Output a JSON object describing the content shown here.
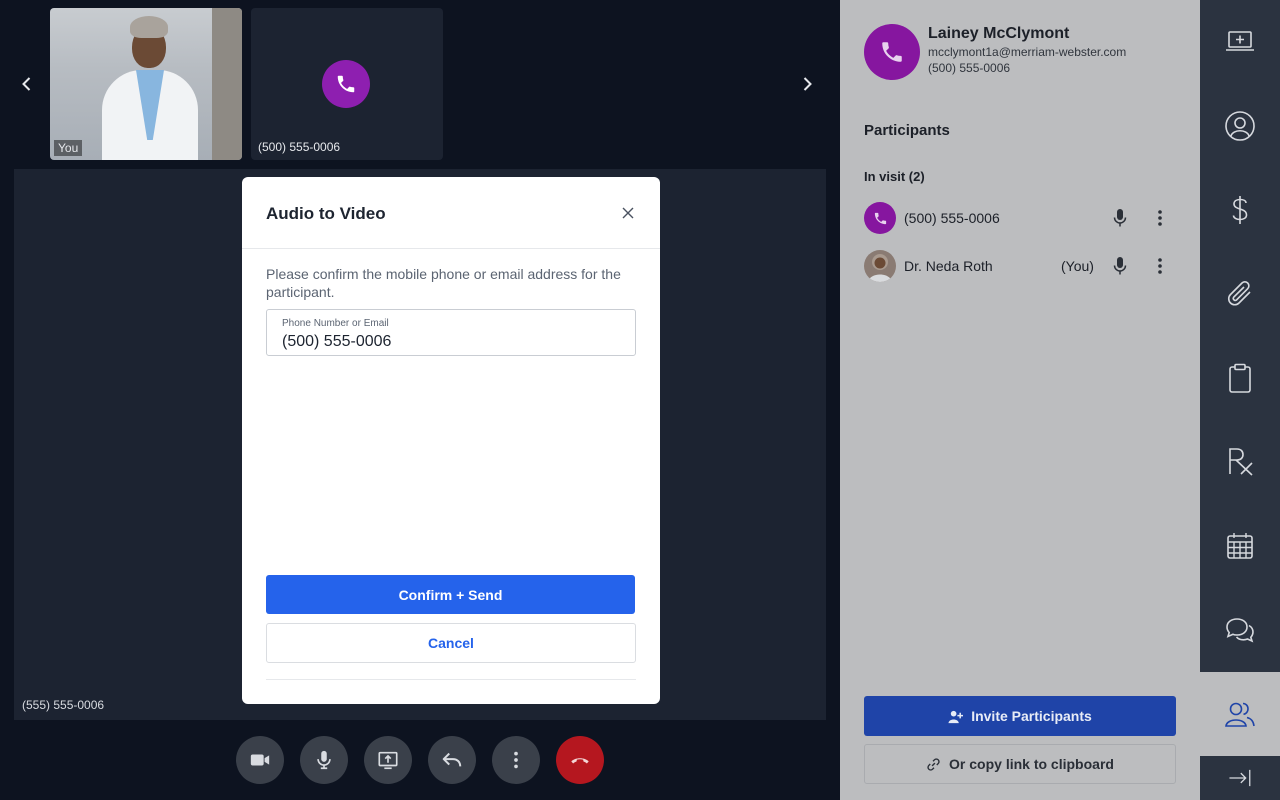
{
  "video": {
    "self_label": "You",
    "phone_tile_label": "(500) 555-0006",
    "stage_label": "(555) 555-0006"
  },
  "modal": {
    "title": "Audio to Video",
    "description": "Please confirm the mobile phone or email address for the participant.",
    "field_label": "Phone Number or Email",
    "field_value": "(500) 555-0006",
    "confirm_label": "Confirm + Send",
    "cancel_label": "Cancel"
  },
  "contact": {
    "name": "Lainey McClymont",
    "email": "mcclymont1a@merriam-webster.com",
    "phone": "(500) 555-0006"
  },
  "participants": {
    "title": "Participants",
    "in_visit": "In visit (2)",
    "items": [
      {
        "name": "(500) 555-0006",
        "you": "",
        "avatar": "phone-icon"
      },
      {
        "name": "Dr. Neda Roth",
        "you": "(You)",
        "avatar": "photo"
      }
    ],
    "invite_label": "Invite Participants",
    "copy_label": "Or copy link to clipboard"
  },
  "rail": {
    "items": [
      "laptop-plus-icon",
      "user-circle-icon",
      "dollar-icon",
      "paperclip-icon",
      "clipboard-icon",
      "rx-icon",
      "calendar-icon",
      "chat-icon",
      "participants-icon",
      "collapse-icon"
    ],
    "active": "participants-icon"
  },
  "colors": {
    "accent": "#2563eb",
    "purple": "#8e1fb0",
    "end_call": "#b5171f",
    "rail_bg": "#2b3340",
    "video_bg": "#0d1320"
  }
}
